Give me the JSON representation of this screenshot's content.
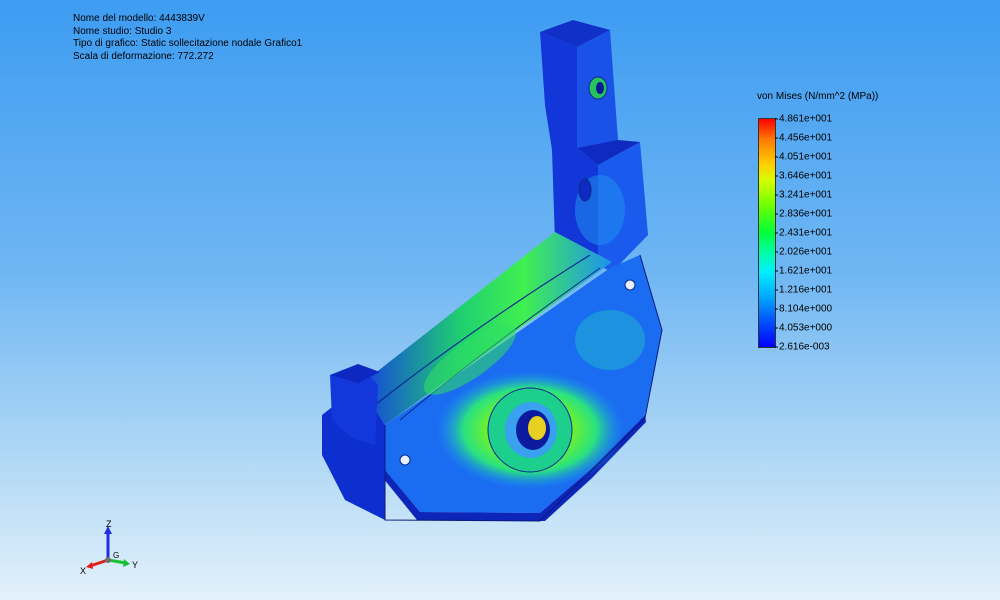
{
  "study_info": {
    "model_name": "Nome del modello: 4443839V",
    "study_name": "Nome studio: Studio 3",
    "plot_type": "Tipo di grafico: Static sollecitazione nodale Grafico1",
    "deformation_scale": "Scala di deformazione: 772.272"
  },
  "legend": {
    "title": "von Mises (N/mm^2 (MPa))",
    "ticks": [
      "4.861e+001",
      "4.456e+001",
      "4.051e+001",
      "3.646e+001",
      "3.241e+001",
      "2.836e+001",
      "2.431e+001",
      "2.026e+001",
      "1.621e+001",
      "1.216e+001",
      "8.104e+000",
      "4.053e+000",
      "2.616e-003"
    ]
  },
  "triad": {
    "z": "Z",
    "x": "X",
    "y": "Y",
    "g": "G"
  },
  "colors": {
    "bg_top": "#3d9cf2",
    "bg_bottom": "#e3f1fb",
    "stress_low": "#0a22d6",
    "stress_mid": "#1fe07a",
    "stress_high": "#ff0000",
    "axis_x": "#e02020",
    "axis_y": "#18c030",
    "axis_z": "#2030e0"
  }
}
